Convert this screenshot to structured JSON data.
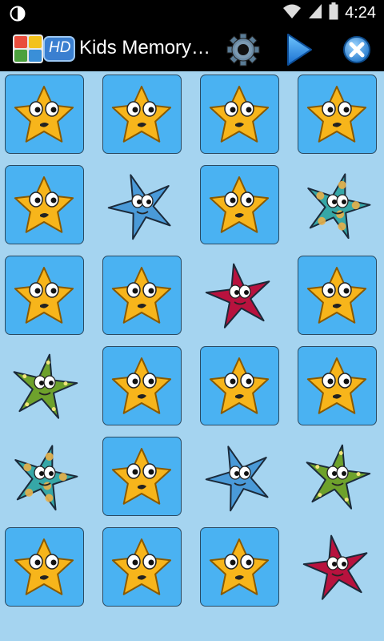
{
  "status_bar": {
    "time": "4:24",
    "icons": [
      "moon-icon",
      "wifi-icon",
      "signal-icon",
      "battery-icon"
    ]
  },
  "action_bar": {
    "app_icon_badge": "HD",
    "title": "Kids Memory…",
    "actions": [
      "settings-gear-icon",
      "play-icon",
      "close-icon"
    ]
  },
  "board": {
    "columns": 4,
    "rows": 6,
    "cards": [
      "hidden",
      "hidden",
      "hidden",
      "hidden",
      "hidden",
      "blue-starfish",
      "hidden",
      "spotted-starfish",
      "hidden",
      "hidden",
      "red-starfish",
      "hidden",
      "green-starfish",
      "hidden",
      "hidden",
      "hidden",
      "spotted-starfish",
      "hidden",
      "blue-starfish",
      "green-starfish",
      "hidden",
      "hidden",
      "hidden",
      "red-starfish"
    ]
  },
  "colors": {
    "background": "#a5d4f0",
    "card_back": "#4ab2f2",
    "card_border": "#2a4a62",
    "star": "#f7b51b",
    "blue_starfish": "#4a9ad8",
    "spotted_starfish": "#36a7a7",
    "red_starfish": "#b8123e",
    "green_starfish": "#6ea12c"
  }
}
